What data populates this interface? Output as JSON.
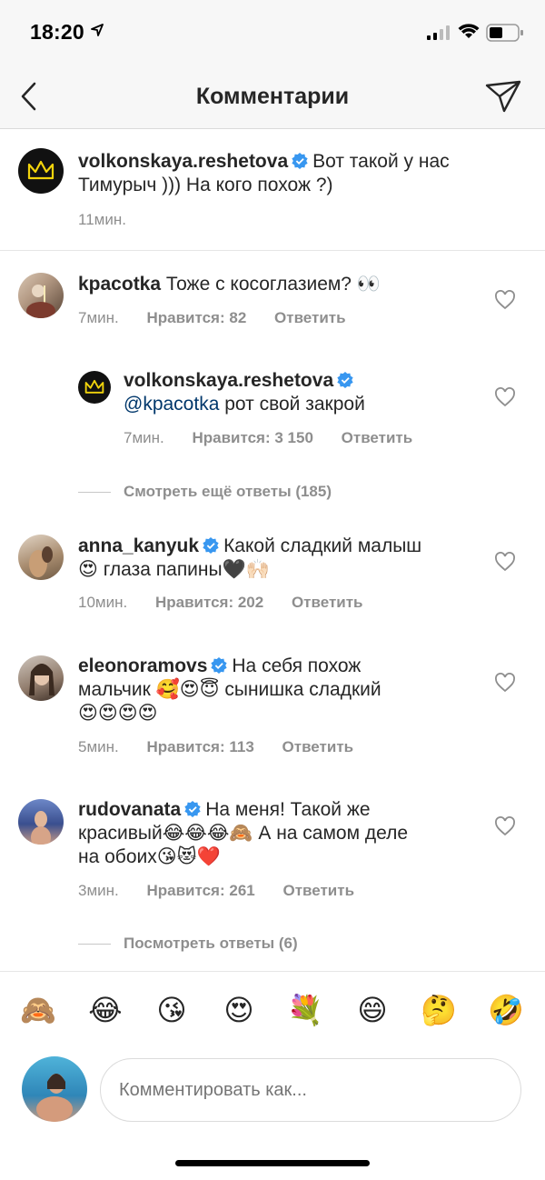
{
  "status": {
    "time": "18:20"
  },
  "nav": {
    "title": "Комментарии"
  },
  "caption": {
    "username": "volkonskaya.reshetova",
    "text_line1": "Вот такой у нас",
    "text_line2": "Тимурыч ))) На кого похож ?)",
    "time": "11мин."
  },
  "comments": [
    {
      "username": "kpacotka",
      "text": "Тоже с косоглазием? 👀",
      "time": "7мин.",
      "likes": "Нравится: 82",
      "reply": "Ответить"
    },
    {
      "username": "volkonskaya.reshetova",
      "mention": "@kpacotka",
      "text": "рот свой закрой",
      "time": "7мин.",
      "likes": "Нравится: 3 150",
      "reply": "Ответить"
    },
    {
      "username": "anna_kanyuk",
      "text_line1": "Какой сладкий малыш",
      "text_line2": "😍 глаза папины🖤🙌🏻",
      "time": "10мин.",
      "likes": "Нравится: 202",
      "reply": "Ответить"
    },
    {
      "username": "eleonoramovs",
      "text_line1": "На себя похож",
      "text_line2": "мальчик 🥰😍😇 сынишка сладкий",
      "text_line3": "😍😍😍😍",
      "time": "5мин.",
      "likes": "Нравится: 113",
      "reply": "Ответить"
    },
    {
      "username": "rudovanata",
      "text_line1": "На меня! Такой же",
      "text_line2": "красивый😂😂😂🙈 А на самом деле",
      "text_line3": "на обоих😘😻❤️",
      "time": "3мин.",
      "likes": "Нравится: 261",
      "reply": "Ответить"
    }
  ],
  "view_more_replies_1": "Смотреть ещё ответы (185)",
  "view_more_replies_2": "Посмотреть ответы (6)",
  "emoji_bar": [
    "🙈",
    "😂",
    "😘",
    "😍",
    "💐",
    "😄",
    "🤔",
    "🤣"
  ],
  "input": {
    "placeholder": "Комментировать как..."
  },
  "colors": {
    "verified": "#3897f0",
    "mention": "#00376b",
    "meta": "#8e8e8e"
  }
}
